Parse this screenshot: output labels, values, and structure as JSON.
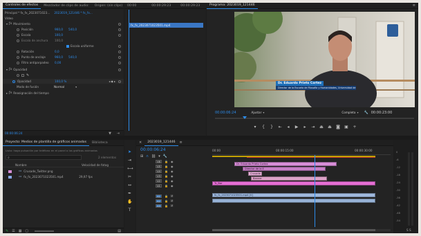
{
  "effect_controls": {
    "tabs": [
      "Controles de efectos",
      "Mezclador de clips de audio:",
      "Origen: (sin clips)",
      "Mezclador de clips de audio"
    ],
    "header_source": "Principal * fx_fx_2023071023...",
    "header_seq": "2023019_121446 * fx_fx...",
    "section_video": "Vídeo",
    "fx_motion": "Movimiento",
    "rows": [
      {
        "label": "Posición",
        "v1": "960,0",
        "v2": "540,0"
      },
      {
        "label": "Escala",
        "v1": "100,0",
        "v2": ""
      },
      {
        "label": "Escala de anchura",
        "v1": "100,0",
        "v2": ""
      },
      {
        "label": "",
        "v1": "",
        "v2": "Escala uniforme"
      },
      {
        "label": "Rotación",
        "v1": "0,0",
        "v2": ""
      },
      {
        "label": "Punto de anclaje",
        "v1": "960,0",
        "v2": "540,0"
      },
      {
        "label": "Filtro antiparpadeo",
        "v1": "0,00",
        "v2": ""
      }
    ],
    "fx_opacity": "Opacidad",
    "opacity_label": "Opacidad",
    "opacity_value": "100,0 %",
    "blend_label": "Modo de fusión",
    "blend_value": "Normal",
    "time_remap": "Reasignación del tiempo",
    "footer_time": "00:00:06:24"
  },
  "source_strip": {
    "tc1": "00:00",
    "tc2": "00:00:29:23",
    "tc3": "00:00:29:23",
    "clip_name": "fx_fx_2023071023501.mp4"
  },
  "program": {
    "title": "Programa: 2023019_121446",
    "lower_third_name": "Dr. Eduardo Prieto Cortez",
    "lower_third_title": "Director de la Escuela de Filosofía y Humanidades, Universidad de Talavera",
    "timecode": "00:00:06:24",
    "fit": "Ajustar",
    "quality": "Completa",
    "duration": "00:00:23:00"
  },
  "project": {
    "tabs": [
      "Proyecto: Medios de plantilla de gráficos animados",
      "Biblioteca"
    ],
    "subtitle": "Carpeta Medios de plantilla de gráficos animados",
    "search_hint": "Listo: haga pulsación por teléfono en el panel o los gráficos animados",
    "items_count": "2 elementos",
    "col_name": "Nombre",
    "col_rate": "Velocidad de fotog",
    "items": [
      {
        "name": "Crusade_Twitter.png",
        "rate": ""
      },
      {
        "name": "fx_fx_2023071023501.mp4",
        "rate": "29,97 fps"
      }
    ]
  },
  "timeline": {
    "tab": "2023019_121446",
    "timecode": "00:00:06:24",
    "ruler": [
      "00:00",
      "00:00:15:00",
      "00:00:30:00"
    ],
    "tracks_video": [
      "V6",
      "V5",
      "V4",
      "V3",
      "V2",
      "V1"
    ],
    "tracks_audio": [
      "A1",
      "A2",
      "A3"
    ],
    "clips": [
      {
        "label": "Dr. Eduardo Prieto Cortez",
        "color": "#d88ed8"
      },
      {
        "label": "Director de la E",
        "color": "#d88ed8"
      },
      {
        "label": "Crusade",
        "color": "#e7b0d8"
      },
      {
        "label": "Banner",
        "color": "#dca2c7"
      },
      {
        "label": "Tc_Bar",
        "color": "#e56fd4"
      },
      {
        "label": "fx_fx_2023071023501.mp4 [V]",
        "color": "#9fb9dd"
      },
      {
        "label": "",
        "color": "#97b2d6"
      }
    ]
  },
  "meters": {
    "scale": [
      "0",
      "-6",
      "-12",
      "-18",
      "-24",
      "-30",
      "-36",
      "-42",
      "-48",
      "-54"
    ],
    "footer": "S S"
  },
  "tools": [
    "selection-tool",
    "track-select-tool",
    "ripple-edit-tool",
    "razor-tool",
    "slip-tool",
    "pen-tool",
    "hand-tool",
    "type-tool"
  ],
  "colors": {
    "accent": "#2d8ceb",
    "playhead": "#2d8ceb",
    "clip_pink": "#d88ed8",
    "clip_blue": "#9fb9dd"
  }
}
